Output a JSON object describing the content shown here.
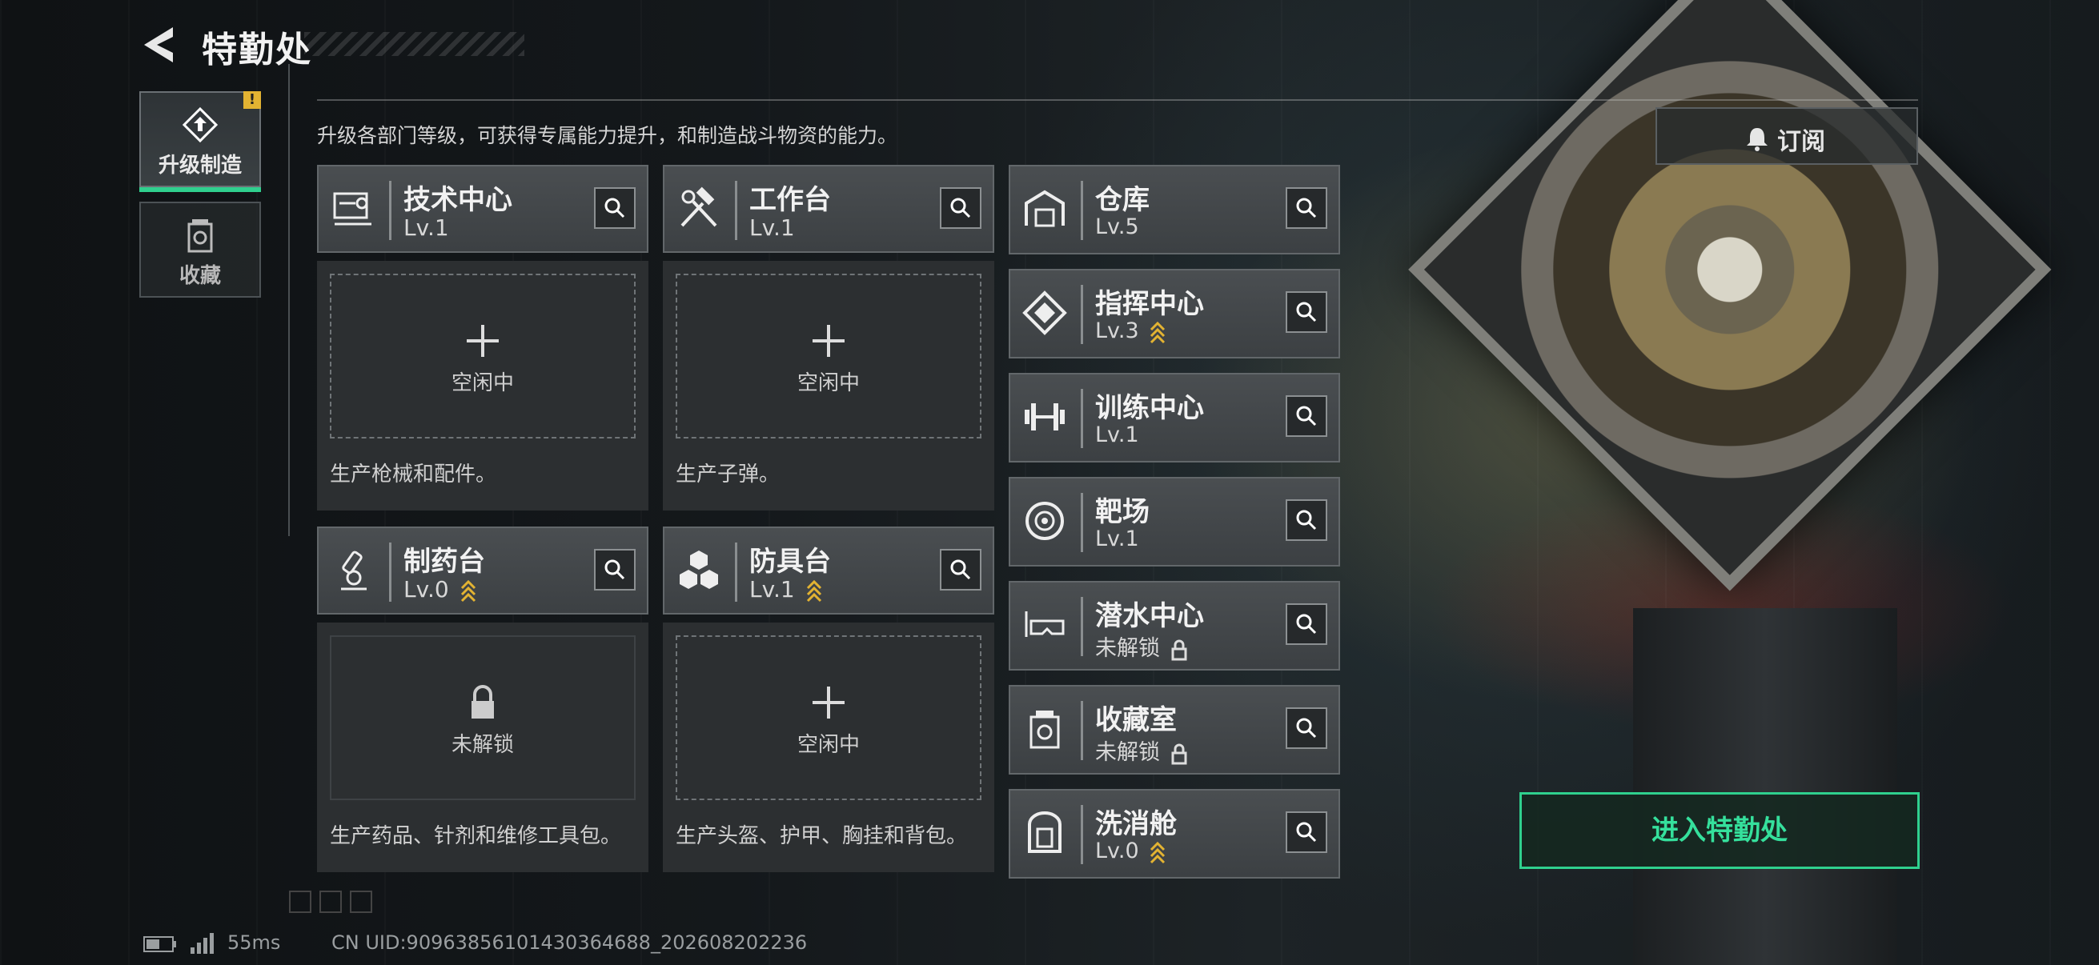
{
  "header": {
    "title": "特勤处"
  },
  "nav": [
    {
      "label": "升级制造",
      "active": true,
      "alert": "!"
    },
    {
      "label": "收藏",
      "active": false
    }
  ],
  "subtitle": "升级各部门等级，可获得专属能力提升，和制造战斗物资的能力。",
  "subscribe_label": "订阅",
  "enter_label": "进入特勤处",
  "grid": [
    {
      "name": "技术中心",
      "level": "Lv.1",
      "upgrade": false,
      "slot_state": "idle",
      "slot_text": "空闲中",
      "desc": "生产枪械和配件。",
      "icon": "tech-center-icon"
    },
    {
      "name": "工作台",
      "level": "Lv.1",
      "upgrade": false,
      "slot_state": "idle",
      "slot_text": "空闲中",
      "desc": "生产子弹。",
      "icon": "workbench-icon"
    },
    {
      "name": "制药台",
      "level": "Lv.0",
      "upgrade": true,
      "slot_state": "locked",
      "slot_text": "未解锁",
      "desc": "生产药品、针剂和维修工具包。",
      "icon": "pharmacy-icon"
    },
    {
      "name": "防具台",
      "level": "Lv.1",
      "upgrade": true,
      "slot_state": "idle",
      "slot_text": "空闲中",
      "desc": "生产头盔、护甲、胸挂和背包。",
      "icon": "armor-bench-icon"
    }
  ],
  "list": [
    {
      "name": "仓库",
      "level": "Lv.5",
      "upgrade": false,
      "locked": false,
      "icon": "warehouse-icon"
    },
    {
      "name": "指挥中心",
      "level": "Lv.3",
      "upgrade": true,
      "locked": false,
      "icon": "command-center-icon"
    },
    {
      "name": "训练中心",
      "level": "Lv.1",
      "upgrade": false,
      "locked": false,
      "icon": "training-center-icon"
    },
    {
      "name": "靶场",
      "level": "Lv.1",
      "upgrade": false,
      "locked": false,
      "icon": "shooting-range-icon"
    },
    {
      "name": "潜水中心",
      "level": "未解锁",
      "upgrade": false,
      "locked": true,
      "icon": "diving-center-icon"
    },
    {
      "name": "收藏室",
      "level": "未解锁",
      "upgrade": false,
      "locked": true,
      "icon": "collection-room-icon"
    },
    {
      "name": "洗消舱",
      "level": "Lv.0",
      "upgrade": true,
      "locked": false,
      "icon": "decon-chamber-icon"
    }
  ],
  "status": {
    "ping": "55ms",
    "uid": "CN UID:9096385610143036468​8_202608202236"
  },
  "colors": {
    "accent": "#2fd08e",
    "upgrade": "#e3b332",
    "alert": "#e3b332"
  }
}
